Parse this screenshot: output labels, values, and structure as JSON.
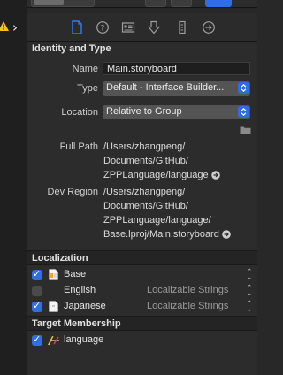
{
  "inspector": {
    "identity_type": {
      "header": "Identity and Type",
      "name_label": "Name",
      "name_value": "Main.storyboard",
      "type_label": "Type",
      "type_value": "Default - Interface Builder...",
      "location_label": "Location",
      "location_value": "Relative to Group",
      "full_path_label": "Full Path",
      "full_path_lines": [
        "/Users/zhangpeng/",
        "Documents/GitHub/",
        "ZPPLanguage/language"
      ],
      "dev_region_label": "Dev Region",
      "dev_region_lines": [
        "/Users/zhangpeng/",
        "Documents/GitHub/",
        "ZPPLanguage/language/",
        "Base.lproj/Main.storyboard"
      ]
    },
    "localization": {
      "header": "Localization",
      "items": [
        {
          "label": "Base",
          "checked": true,
          "sub": ""
        },
        {
          "label": "English",
          "checked": false,
          "sub": "Localizable Strings"
        },
        {
          "label": "Japanese",
          "checked": true,
          "sub": "Localizable Strings"
        }
      ]
    },
    "target_membership": {
      "header": "Target Membership",
      "items": [
        {
          "label": "language",
          "checked": true
        }
      ]
    }
  },
  "colors": {
    "accent": "#2f6fe3",
    "panel": "#2c2c2c",
    "warning": "#f5c518"
  }
}
